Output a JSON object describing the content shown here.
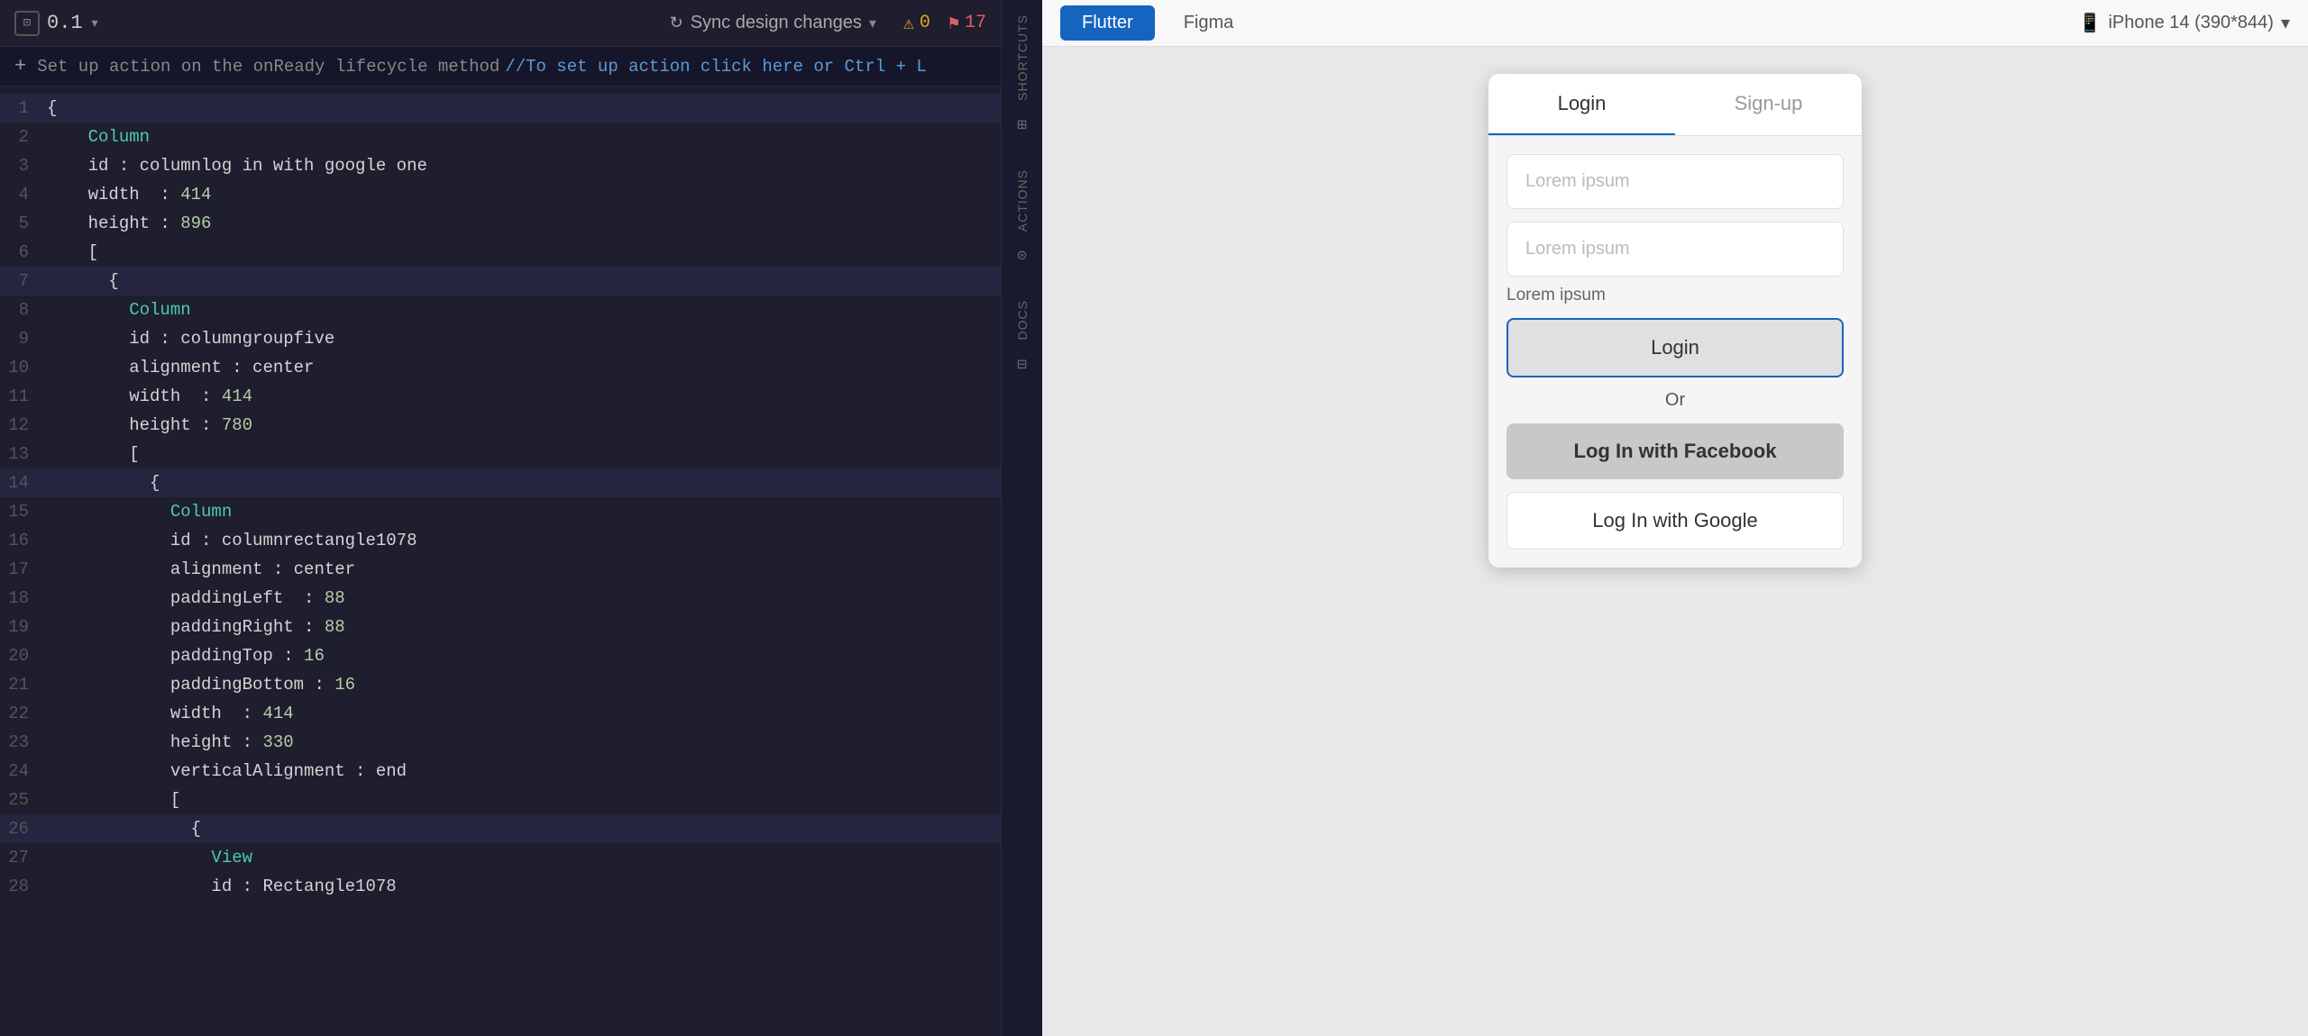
{
  "editor": {
    "file_name": "0.1",
    "sync_label": "Sync design changes",
    "warning_count": "0",
    "error_count": "17",
    "lifecycle_text": "Set up action on the onReady lifecycle method",
    "lifecycle_link": "//To set up action click here or Ctrl + L",
    "lines": [
      {
        "num": "1",
        "tokens": [
          {
            "t": "{ ",
            "c": "c-white"
          }
        ],
        "active": true
      },
      {
        "num": "2",
        "tokens": [
          {
            "t": "    Column",
            "c": "c-teal"
          }
        ]
      },
      {
        "num": "3",
        "tokens": [
          {
            "t": "    id : columnlog in with google one",
            "c": "c-white"
          }
        ]
      },
      {
        "num": "4",
        "tokens": [
          {
            "t": "    width  : ",
            "c": "c-white"
          },
          {
            "t": "414",
            "c": "c-num"
          }
        ]
      },
      {
        "num": "5",
        "tokens": [
          {
            "t": "    height : ",
            "c": "c-white"
          },
          {
            "t": "896",
            "c": "c-num"
          }
        ]
      },
      {
        "num": "6",
        "tokens": [
          {
            "t": "    [",
            "c": "c-white"
          }
        ]
      },
      {
        "num": "7",
        "tokens": [
          {
            "t": "      {",
            "c": "c-white"
          }
        ],
        "active": true
      },
      {
        "num": "8",
        "tokens": [
          {
            "t": "        Column",
            "c": "c-teal"
          }
        ]
      },
      {
        "num": "9",
        "tokens": [
          {
            "t": "        id : columngroupfive",
            "c": "c-white"
          }
        ]
      },
      {
        "num": "10",
        "tokens": [
          {
            "t": "        alignment : center",
            "c": "c-white"
          }
        ]
      },
      {
        "num": "11",
        "tokens": [
          {
            "t": "        width  : ",
            "c": "c-white"
          },
          {
            "t": "414",
            "c": "c-num"
          }
        ]
      },
      {
        "num": "12",
        "tokens": [
          {
            "t": "        height : ",
            "c": "c-white"
          },
          {
            "t": "780",
            "c": "c-num"
          }
        ]
      },
      {
        "num": "13",
        "tokens": [
          {
            "t": "        [",
            "c": "c-white"
          }
        ]
      },
      {
        "num": "14",
        "tokens": [
          {
            "t": "          {",
            "c": "c-white"
          }
        ],
        "active": true
      },
      {
        "num": "15",
        "tokens": [
          {
            "t": "            Column",
            "c": "c-teal"
          }
        ]
      },
      {
        "num": "16",
        "tokens": [
          {
            "t": "            id : columnrectangle1078",
            "c": "c-white"
          }
        ]
      },
      {
        "num": "17",
        "tokens": [
          {
            "t": "            alignment : center",
            "c": "c-white"
          }
        ]
      },
      {
        "num": "18",
        "tokens": [
          {
            "t": "            paddingLeft  : ",
            "c": "c-white"
          },
          {
            "t": "88",
            "c": "c-num"
          }
        ]
      },
      {
        "num": "19",
        "tokens": [
          {
            "t": "            paddingRight : ",
            "c": "c-white"
          },
          {
            "t": "88",
            "c": "c-num"
          }
        ]
      },
      {
        "num": "20",
        "tokens": [
          {
            "t": "            paddingTop : ",
            "c": "c-white"
          },
          {
            "t": "16",
            "c": "c-num"
          }
        ]
      },
      {
        "num": "21",
        "tokens": [
          {
            "t": "            paddingBottom : ",
            "c": "c-white"
          },
          {
            "t": "16",
            "c": "c-num"
          }
        ]
      },
      {
        "num": "22",
        "tokens": [
          {
            "t": "            width  : ",
            "c": "c-white"
          },
          {
            "t": "414",
            "c": "c-num"
          }
        ]
      },
      {
        "num": "23",
        "tokens": [
          {
            "t": "            height : ",
            "c": "c-white"
          },
          {
            "t": "330",
            "c": "c-num"
          }
        ]
      },
      {
        "num": "24",
        "tokens": [
          {
            "t": "            verticalAlignment : end",
            "c": "c-white"
          }
        ]
      },
      {
        "num": "25",
        "tokens": [
          {
            "t": "            [",
            "c": "c-white"
          }
        ]
      },
      {
        "num": "26",
        "tokens": [
          {
            "t": "              {",
            "c": "c-white"
          }
        ],
        "active": true
      },
      {
        "num": "27",
        "tokens": [
          {
            "t": "                View",
            "c": "c-teal"
          }
        ]
      },
      {
        "num": "28",
        "tokens": [
          {
            "t": "                id : Rectangle1078",
            "c": "c-white"
          }
        ]
      }
    ]
  },
  "side": {
    "shortcuts_label": "SHORTCUTS",
    "actions_label": "ACTIONS",
    "docs_label": "DOCS"
  },
  "preview": {
    "flutter_btn": "Flutter",
    "figma_btn": "Figma",
    "device_label": "iPhone 14  (390*844)",
    "tabs": [
      {
        "label": "Login",
        "active": true
      },
      {
        "label": "Sign-up",
        "active": false
      }
    ],
    "input1_placeholder": "Lorem ipsum",
    "input2_placeholder": "Lorem ipsum",
    "forgot_label": "Lorem ipsum",
    "login_btn": "Login",
    "or_label": "Or",
    "facebook_btn": "Log In with Facebook",
    "google_btn": "Log In with Google"
  }
}
